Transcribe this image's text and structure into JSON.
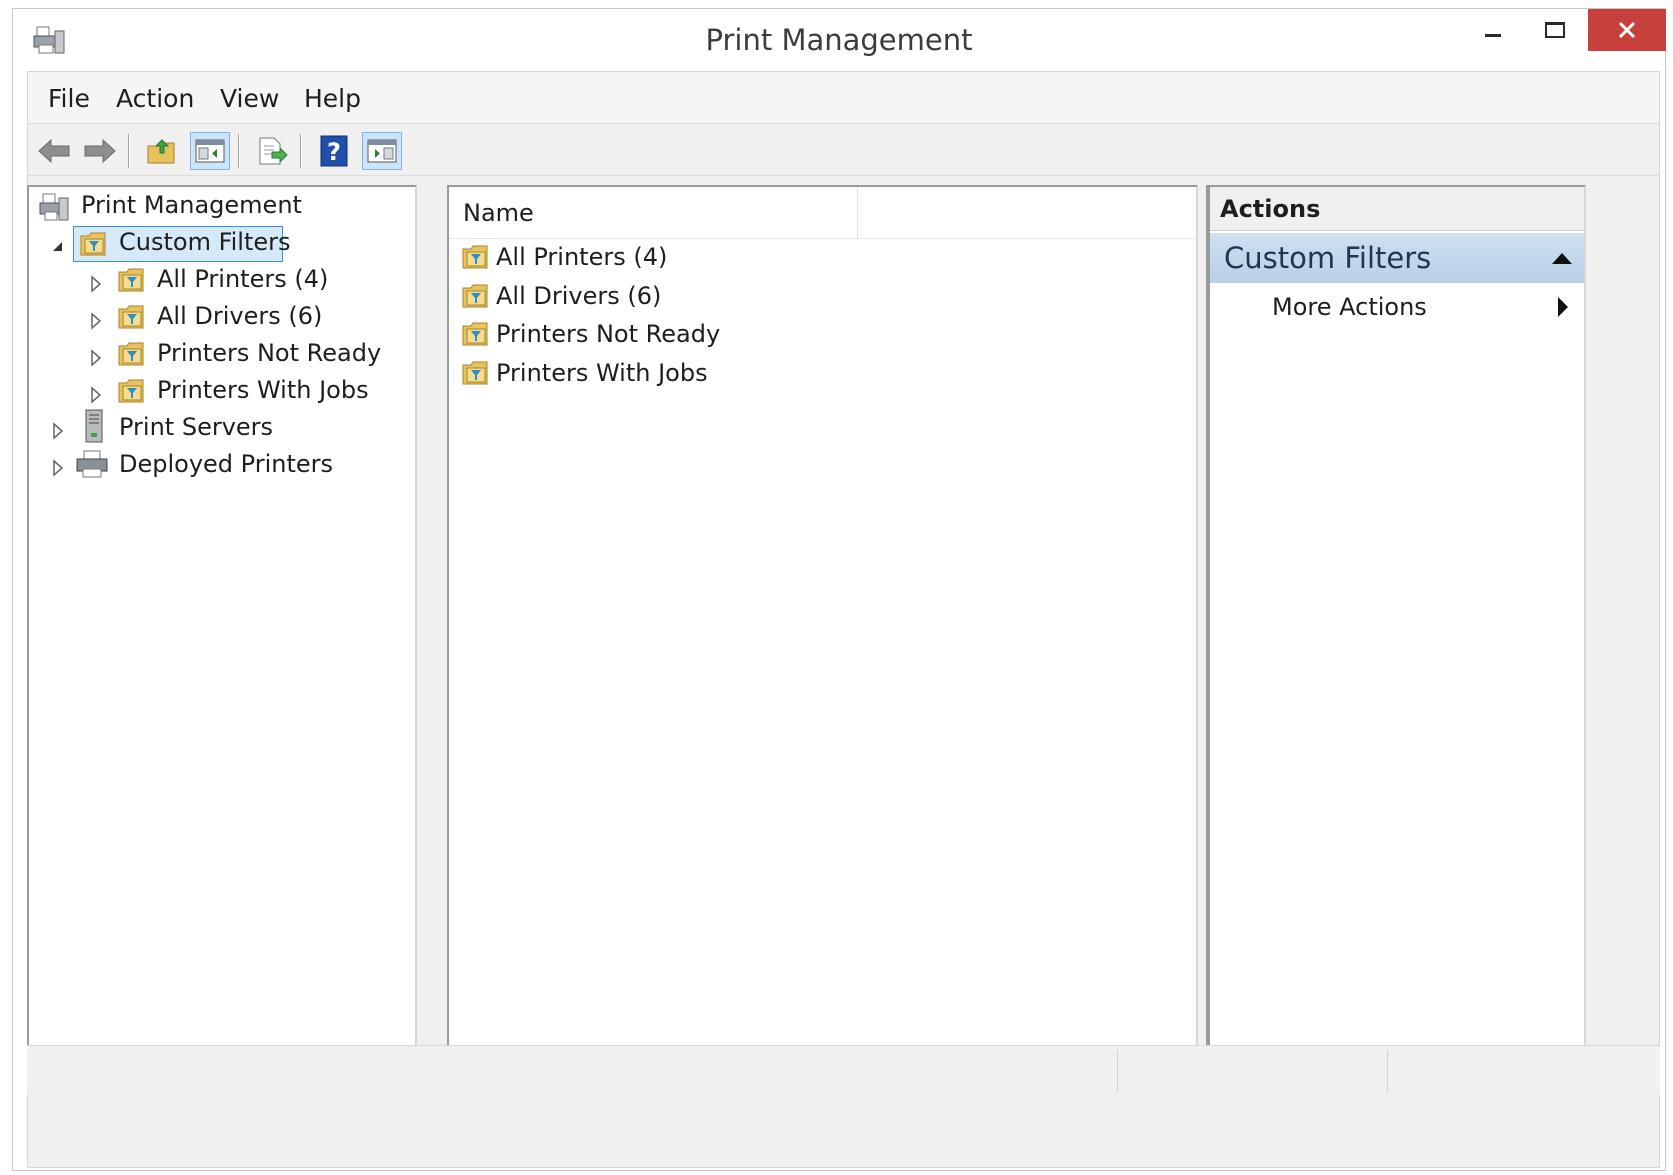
{
  "window": {
    "title": "Print Management",
    "controls": {
      "minimize": "minimize-icon",
      "maximize": "maximize-icon",
      "close": "close-icon"
    }
  },
  "menu": [
    "File",
    "Action",
    "View",
    "Help"
  ],
  "toolbar": {
    "buttons": [
      "back-arrow-icon",
      "forward-arrow-icon",
      "up-folder-icon",
      "show-hide-console-tree-icon",
      "export-list-icon",
      "help-icon",
      "show-hide-action-pane-icon"
    ],
    "active": [
      "show-hide-console-tree-icon",
      "show-hide-action-pane-icon"
    ]
  },
  "tree": {
    "root": {
      "label": "Print Management",
      "icon": "print-management-icon"
    },
    "items": [
      {
        "label": "Custom Filters",
        "level": 1,
        "expanded": true,
        "selected": true,
        "icon": "filter-folder-icon"
      },
      {
        "label": "All Printers (4)",
        "level": 2,
        "expanded": false,
        "icon": "filter-folder-icon"
      },
      {
        "label": "All Drivers (6)",
        "level": 2,
        "expanded": false,
        "icon": "filter-folder-icon"
      },
      {
        "label": "Printers Not Ready",
        "level": 2,
        "expanded": false,
        "icon": "filter-folder-icon"
      },
      {
        "label": "Printers With Jobs",
        "level": 2,
        "expanded": false,
        "icon": "filter-folder-icon"
      },
      {
        "label": "Print Servers",
        "level": 1,
        "expanded": false,
        "icon": "server-icon"
      },
      {
        "label": "Deployed Printers",
        "level": 1,
        "expanded": false,
        "icon": "printer-icon"
      }
    ]
  },
  "list": {
    "columns": [
      "Name"
    ],
    "items": [
      "All Printers (4)",
      "All Drivers (6)",
      "Printers Not Ready",
      "Printers With Jobs"
    ]
  },
  "actions": {
    "title": "Actions",
    "section": "Custom Filters",
    "items": [
      "More Actions"
    ]
  },
  "colors": {
    "close_button": "#c8403c",
    "selection": "#d6e9f8",
    "selection_border": "#3d92d9",
    "action_section": "#c4d8ec"
  }
}
